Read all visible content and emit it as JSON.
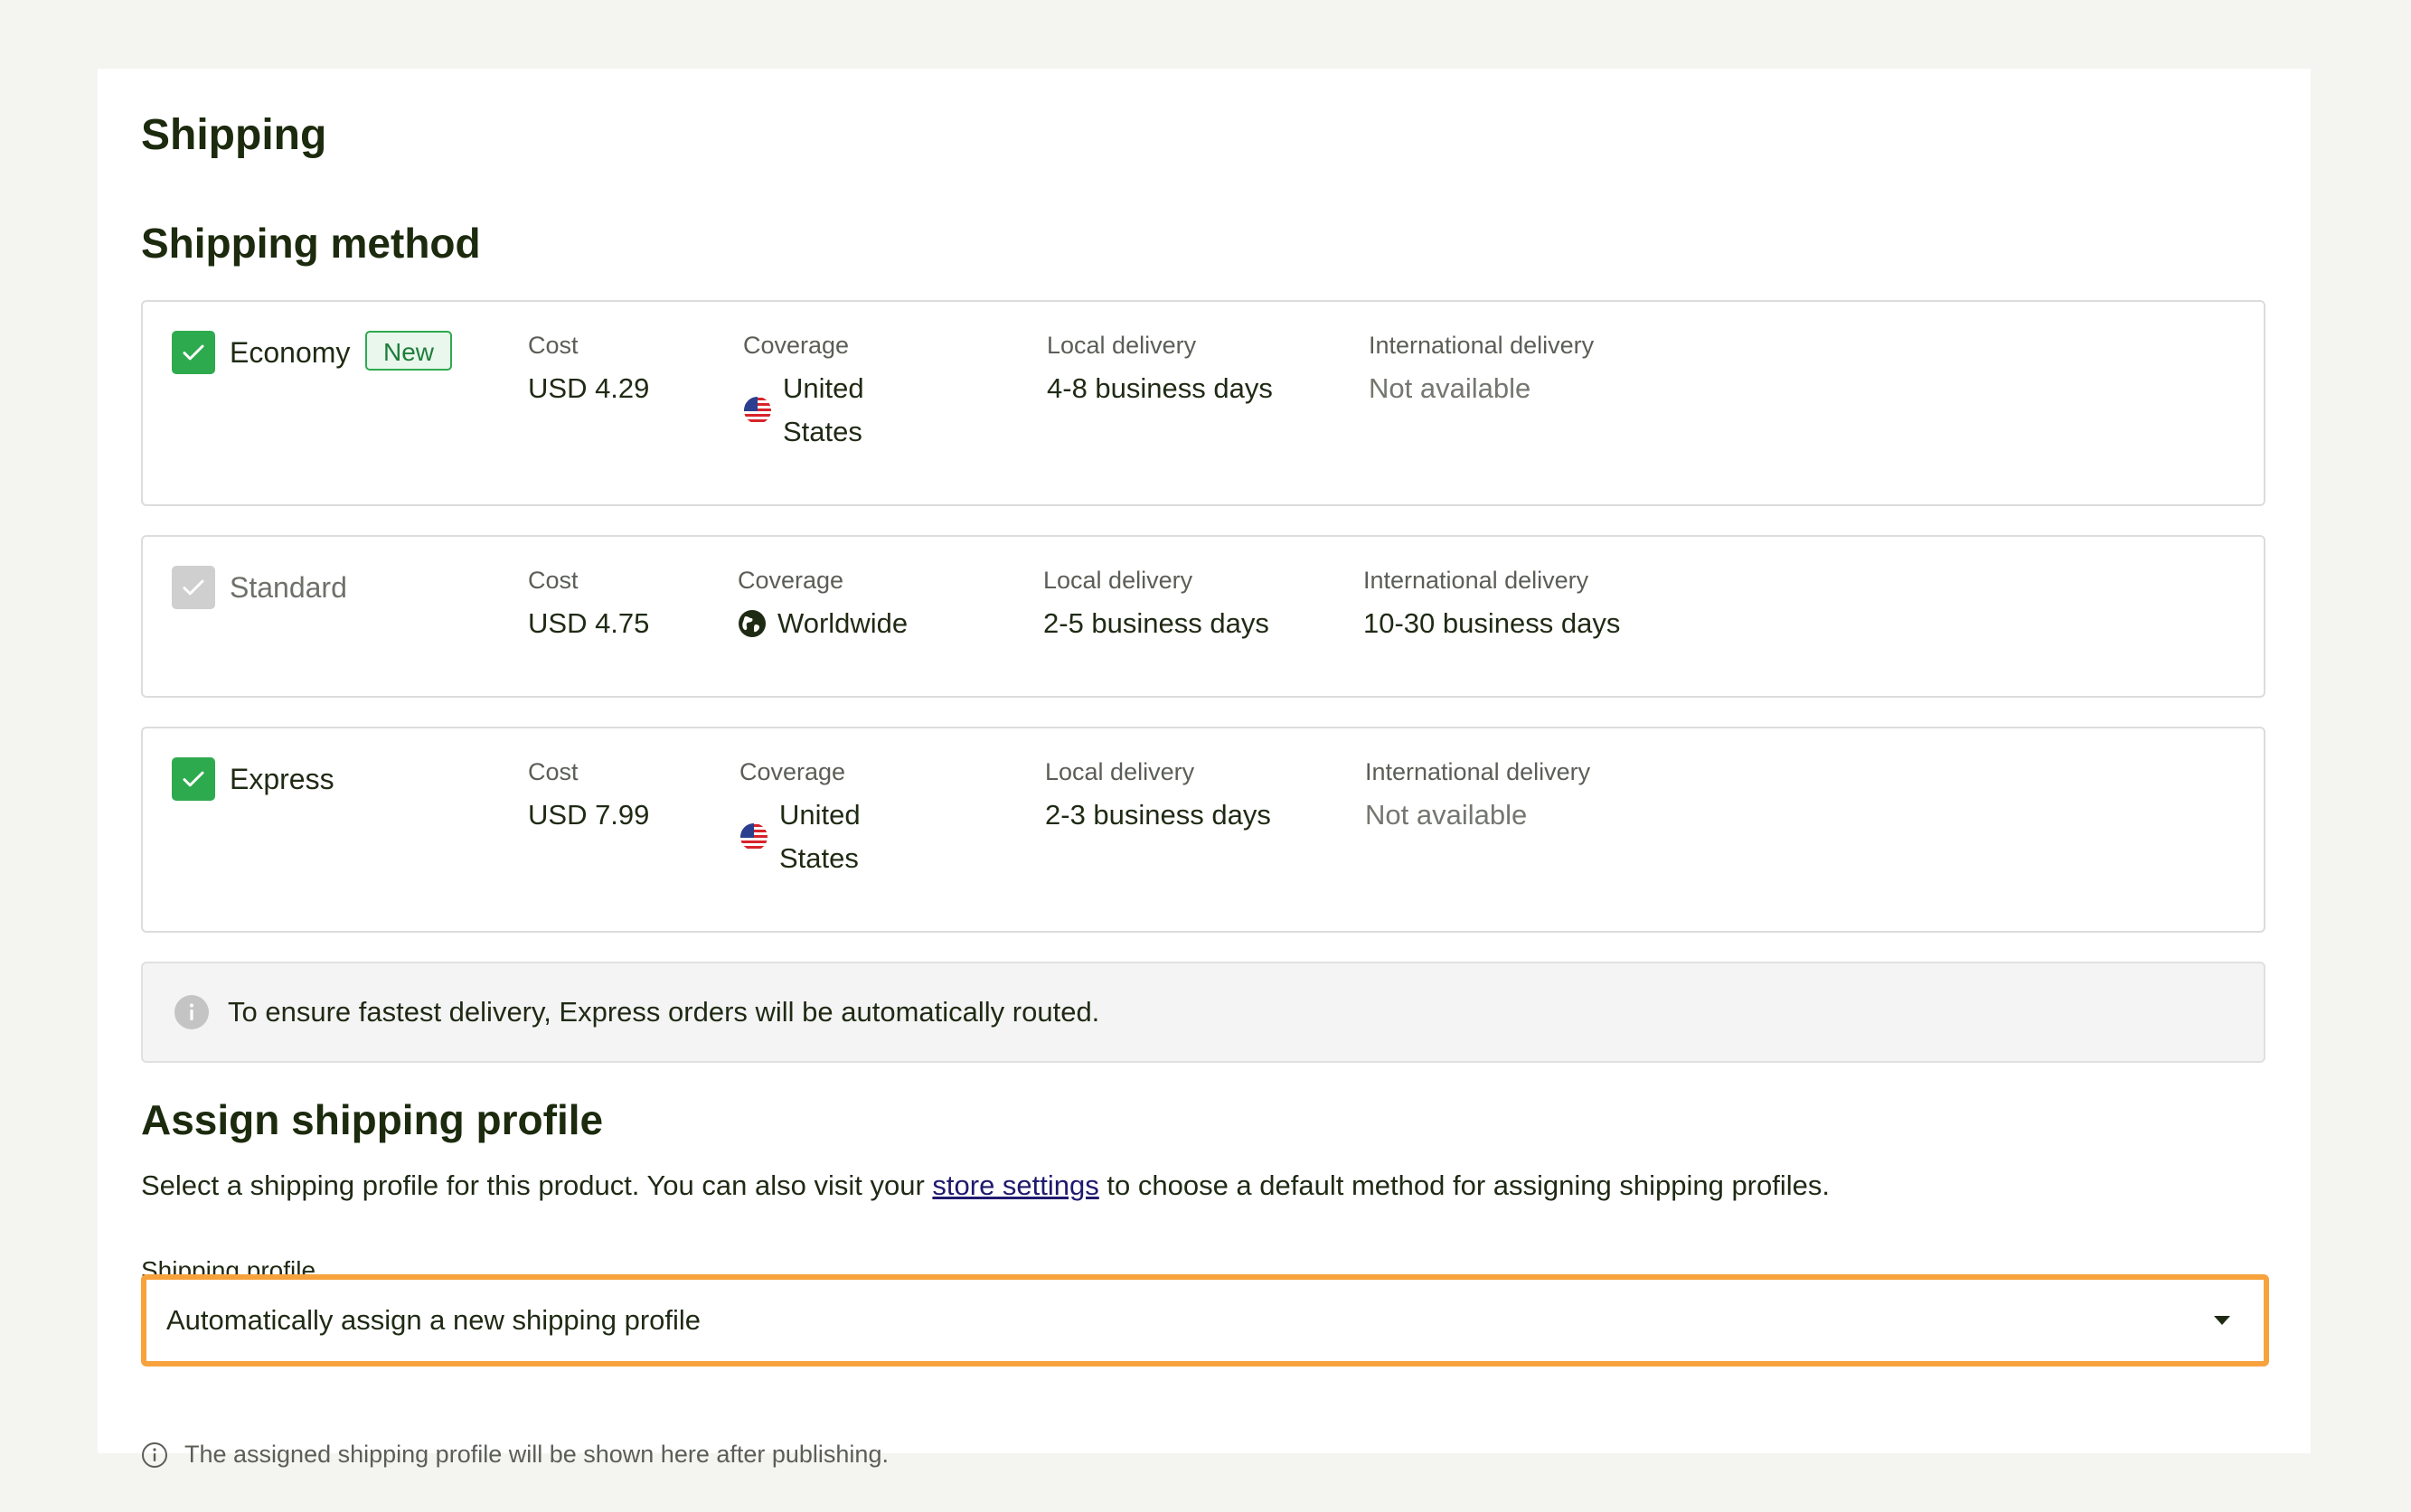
{
  "page": {
    "title": "Shipping"
  },
  "shipping_method": {
    "title": "Shipping method",
    "columns": {
      "cost": "Cost",
      "coverage": "Coverage",
      "local": "Local delivery",
      "international": "International delivery"
    },
    "methods": [
      {
        "name": "Economy",
        "badge": "New",
        "checked": true,
        "enabled": true,
        "cost": "USD 4.29",
        "coverage_line1": "United",
        "coverage_line2": "States",
        "coverage_icon": "us-flag-icon",
        "local": "4-8 business days",
        "international": "Not available"
      },
      {
        "name": "Standard",
        "checked": true,
        "enabled": false,
        "cost": "USD 4.75",
        "coverage": "Worldwide",
        "coverage_icon": "globe-icon",
        "local": "2-5 business days",
        "international": "10-30 business days"
      },
      {
        "name": "Express",
        "checked": true,
        "enabled": true,
        "cost": "USD 7.99",
        "coverage_line1": "United",
        "coverage_line2": "States",
        "coverage_icon": "us-flag-icon",
        "local": "2-3 business days",
        "international": "Not available"
      }
    ],
    "notice": "To ensure fastest delivery, Express orders will be automatically routed."
  },
  "assign_profile": {
    "title": "Assign shipping profile",
    "description_before": "Select a shipping profile for this product. You can also visit your ",
    "description_link": "store settings",
    "description_after": " to choose a default method for assigning shipping profiles.",
    "field_label": "Shipping profile",
    "selected_value": "Automatically assign a new shipping profile",
    "helper_text": "The assigned shipping profile will be shown here after publishing."
  },
  "colors": {
    "accent_green": "#2eaa4e",
    "focus_orange": "#f7a23d",
    "heading": "#1c2a0e"
  }
}
